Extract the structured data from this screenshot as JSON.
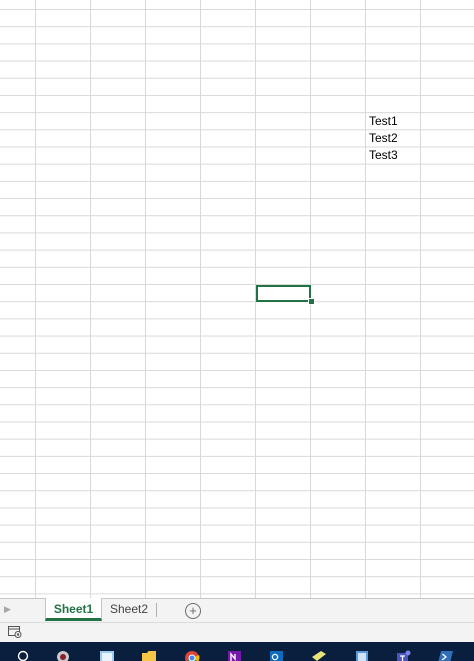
{
  "cells": [
    {
      "ref": "G7",
      "value": "Test1"
    },
    {
      "ref": "G8",
      "value": "Test2"
    },
    {
      "ref": "G9",
      "value": "Test3"
    }
  ],
  "active_cell": "E17",
  "sheet_tabs": [
    {
      "label": "Sheet1",
      "active": true
    },
    {
      "label": "Sheet2",
      "active": false
    }
  ],
  "colors": {
    "accent": "#217346",
    "taskbar": "#0a1e3e",
    "gridline": "#d9d9d9"
  },
  "icons": {
    "add_sheet": "plus-circle-icon",
    "status": "macro-record-icon",
    "taskbar": [
      "search-icon",
      "app-icon",
      "photos-icon",
      "file-explorer-icon",
      "chrome-icon",
      "onenote-icon",
      "outlook-icon",
      "notes-icon",
      "app-icon",
      "teams-icon",
      "powershell-icon"
    ]
  }
}
